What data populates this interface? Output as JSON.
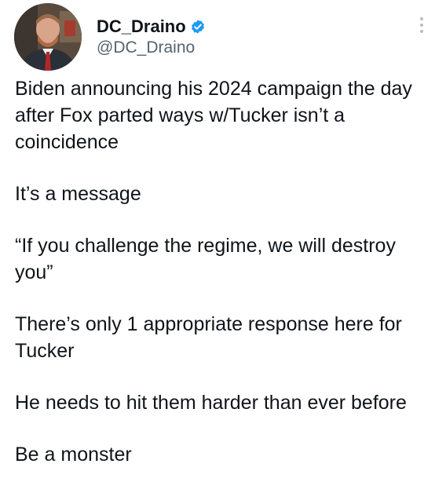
{
  "author": {
    "display_name": "DC_Draino",
    "handle": "@DC_Draino",
    "verified_icon": "verified-badge-icon",
    "avatar_icon": "profile-photo"
  },
  "menu": {
    "icon": "more-options-icon"
  },
  "tweet": {
    "paragraphs": [
      "Biden announcing his 2024 campaign the day after Fox parted ways w/Tucker isn’t a coincidence",
      "It’s a message",
      "“If you challenge the regime, we will destroy you”",
      "There’s only 1 appropriate response here for Tucker",
      "He needs to hit them harder than ever before",
      "Be a monster"
    ]
  },
  "colors": {
    "text": "#0f1419",
    "secondary": "#536471",
    "verified": "#1d9bf0"
  }
}
